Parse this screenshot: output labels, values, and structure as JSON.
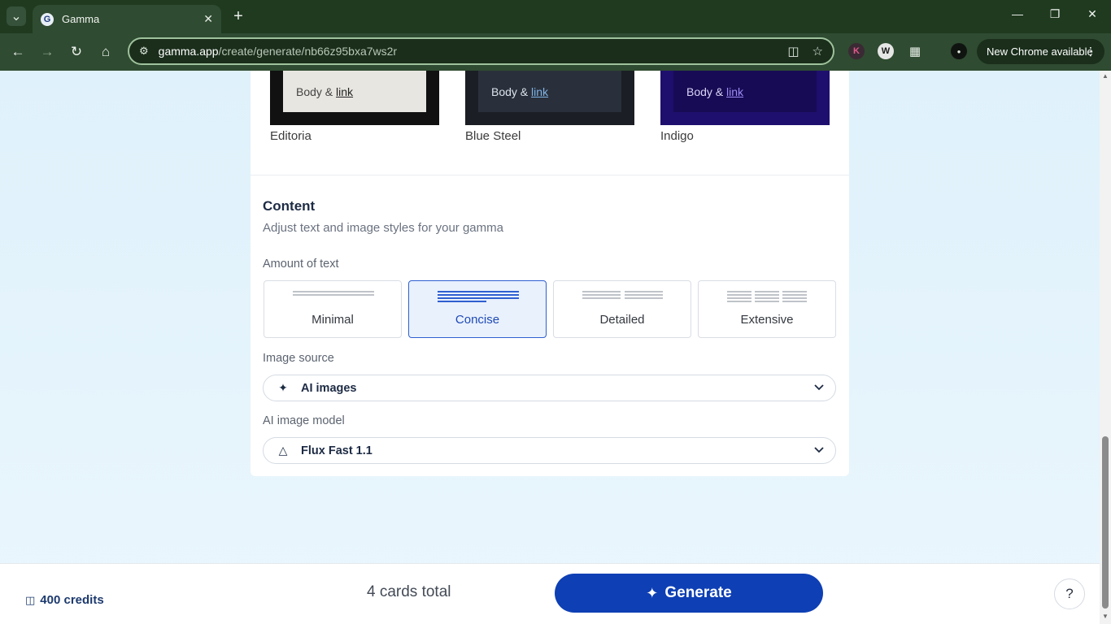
{
  "browser": {
    "tab_title": "Gamma",
    "url_host": "gamma.app",
    "url_path": "/create/generate/nb66z95bxa7ws2r",
    "update_label": "New Chrome available"
  },
  "themes": [
    {
      "name": "Editoria",
      "body": "Body & ",
      "link": "link"
    },
    {
      "name": "Blue Steel",
      "body": "Body & ",
      "link": "link"
    },
    {
      "name": "Indigo",
      "body": "Body & ",
      "link": "link"
    }
  ],
  "content": {
    "title": "Content",
    "subtitle": "Adjust text and image styles for your gamma",
    "amount_label": "Amount of text",
    "amount_options": [
      "Minimal",
      "Concise",
      "Detailed",
      "Extensive"
    ],
    "amount_selected": "Concise",
    "image_source_label": "Image source",
    "image_source_value": "AI images",
    "image_model_label": "AI image model",
    "image_model_value": "Flux Fast 1.1"
  },
  "footer": {
    "credits": "400 credits",
    "cards_total": "4 cards total",
    "generate_label": "Generate",
    "help": "?"
  }
}
